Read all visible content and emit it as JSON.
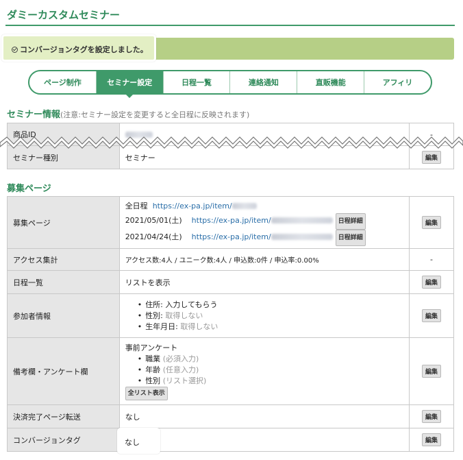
{
  "page_title": "ダミーカスタムセミナー",
  "alert": {
    "message": "コンバージョンタグを設定しました。",
    "icon": "check-circle-icon"
  },
  "tabs": [
    {
      "label": "ページ制作",
      "active": false
    },
    {
      "label": "セミナー設定",
      "active": true
    },
    {
      "label": "日程一覧",
      "active": false
    },
    {
      "label": "連絡通知",
      "active": false
    },
    {
      "label": "直販機能",
      "active": false
    },
    {
      "label": "アフィリ",
      "active": false
    }
  ],
  "seminar_info": {
    "title": "セミナー情報",
    "note": "(注意:セミナー設定を変更すると全日程に反映されます)",
    "rows": {
      "product_id": {
        "label": "商品ID",
        "action": "-"
      },
      "seminar_type": {
        "label": "セミナー種別",
        "value": "セミナー",
        "action": "編集"
      }
    }
  },
  "recruit": {
    "title": "募集ページ",
    "page": {
      "label": "募集ページ",
      "all_label": "全日程",
      "all_url": "https://ex-pa.jp/item/",
      "date1": "2021/05/01(土)",
      "date1_url": "https://ex-pa.jp/item/",
      "date2": "2021/04/24(土)",
      "date2_url": "https://ex-pa.jp/item/",
      "detail_btn": "日程詳細",
      "action": "編集"
    },
    "access": {
      "label": "アクセス集計",
      "value": "アクセス数:4人 / ユニーク数:4人 / 申込数:0件 / 申込率:0.00%",
      "action": "-"
    },
    "schedule": {
      "label": "日程一覧",
      "value": "リストを表示",
      "action": "編集"
    },
    "participant": {
      "label": "参加者情報",
      "items": [
        {
          "name": "住所:",
          "status": "入力してもらう"
        },
        {
          "name": "性別:",
          "status": "取得しない"
        },
        {
          "name": "生年月日:",
          "status": "取得しない"
        }
      ],
      "action": "編集"
    },
    "survey": {
      "label": "備考欄・アンケート欄",
      "heading": "事前アンケート",
      "items": [
        {
          "name": "職業",
          "note": "(必須入力)"
        },
        {
          "name": "年齢",
          "note": "(任意入力)"
        },
        {
          "name": "性別",
          "note": "(リスト選択)"
        }
      ],
      "list_btn": "全リスト表示",
      "action": "編集"
    },
    "redirect": {
      "label": "決済完了ページ転送",
      "value": "なし",
      "action": "編集"
    },
    "conversion": {
      "label": "コンバージョンタグ",
      "value": "なし",
      "action": "編集"
    }
  }
}
